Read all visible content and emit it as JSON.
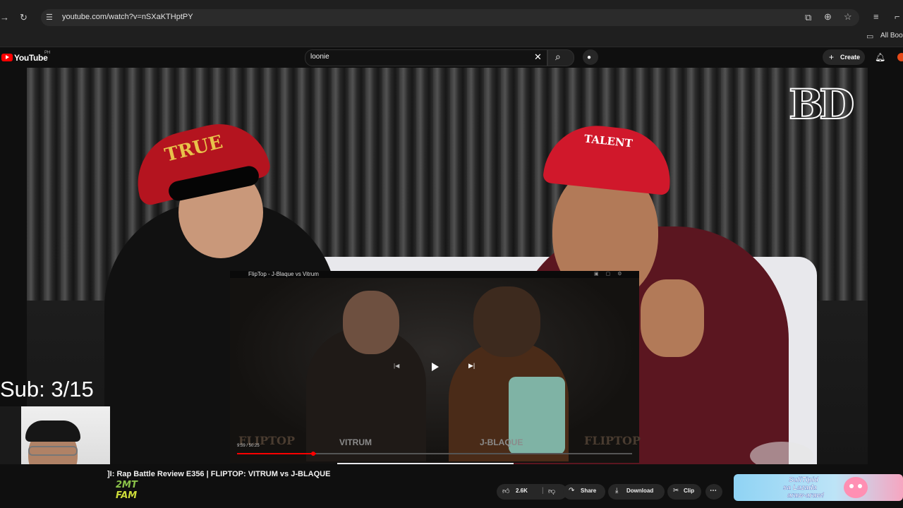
{
  "browser": {
    "url": "youtube.com/watch?v=nSXaKTHptPY",
    "bookmarks_label": "All Boo"
  },
  "youtube": {
    "logo_text": "YouTube",
    "region": "PH",
    "search_value": "loonie",
    "create_label": "Create"
  },
  "video": {
    "channel_watermark": "BD",
    "cap_left_text": "TRUE",
    "cap_right_text": "TALENT",
    "title": "]I: Rap Battle Review E356 | FLIPTOP: VITRUM vs J-BLAQUE"
  },
  "embed": {
    "title": "FlipTop - J-Blaque vs Vitrum",
    "time": "9:59 / 50:25",
    "left_name": "VITRUM",
    "right_name": "J-BLAQUE",
    "brand": "FLIPTOP",
    "progress_fraction": 0.2
  },
  "overlay": {
    "sub_counter": "Sub: 3/15"
  },
  "channel_badge": {
    "line1": "2MT",
    "line2": "FAM"
  },
  "actions": {
    "likes": "2.6K",
    "share": "Share",
    "download": "Download",
    "clip": "Clip",
    "more": "⋯"
  },
  "ad": {
    "line1": "SuliTipid",
    "line2": "sa Lazada",
    "line3": "araw-araw!"
  },
  "icons": {
    "reload": "↻",
    "site_info": "⚙",
    "install": "⇩",
    "zoom": "⌕",
    "star": "☆",
    "bookmark_folder": "▭",
    "search": "⌕",
    "mic": "🎙",
    "bell": "🔔",
    "clear": "✕"
  }
}
